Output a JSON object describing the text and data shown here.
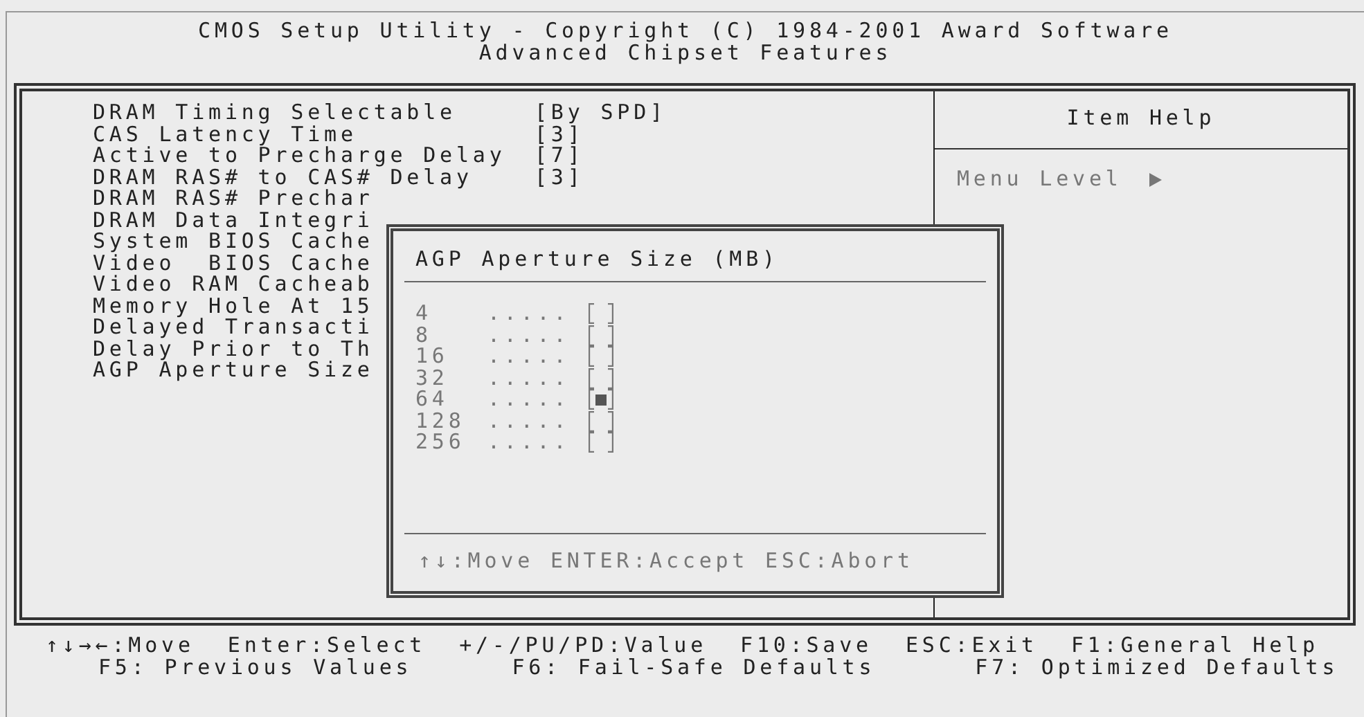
{
  "header": {
    "title": "CMOS Setup Utility - Copyright (C) 1984-2001 Award Software",
    "subtitle": "Advanced Chipset Features"
  },
  "items": [
    {
      "label": "DRAM Timing Selectable",
      "value": "[By SPD]"
    },
    {
      "label": "CAS Latency Time",
      "value": "[3]"
    },
    {
      "label": "Active to Precharge Delay",
      "value": "[7]"
    },
    {
      "label": "DRAM RAS# to CAS# Delay",
      "value": "[3]"
    },
    {
      "label": "DRAM RAS# Prechar"
    },
    {
      "label": "DRAM Data Integri"
    },
    {
      "label": "System BIOS Cache"
    },
    {
      "label": "Video  BIOS Cache"
    },
    {
      "label": "Video RAM Cacheab"
    },
    {
      "label": "Memory Hole At 15"
    },
    {
      "label": "Delayed Transacti"
    },
    {
      "label": "Delay Prior to Th"
    },
    {
      "label": "AGP Aperture Size"
    }
  ],
  "item_help": {
    "title": "Item Help",
    "menu_level": "Menu Level"
  },
  "popup": {
    "title": "AGP Aperture Size (MB)",
    "options": [
      {
        "label": "4",
        "leader": ".....",
        "selected": false
      },
      {
        "label": "8",
        "leader": ".....",
        "selected": false
      },
      {
        "label": "16",
        "leader": ".....",
        "selected": false
      },
      {
        "label": "32",
        "leader": ".....",
        "selected": false
      },
      {
        "label": "64",
        "leader": ".....",
        "selected": true
      },
      {
        "label": "128",
        "leader": ".....",
        "selected": false
      },
      {
        "label": "256",
        "leader": ".....",
        "selected": false
      }
    ],
    "footer": "↑↓:Move ENTER:Accept ESC:Abort"
  },
  "status_bar": [
    [
      "↑↓→←:Move",
      "Enter:Select",
      "+/-/PU/PD:Value",
      "F10:Save",
      "ESC:Exit",
      "F1:General Help"
    ],
    [
      "F5: Previous Values",
      "F6: Fail-Safe Defaults",
      "F7: Optimized Defaults"
    ]
  ]
}
